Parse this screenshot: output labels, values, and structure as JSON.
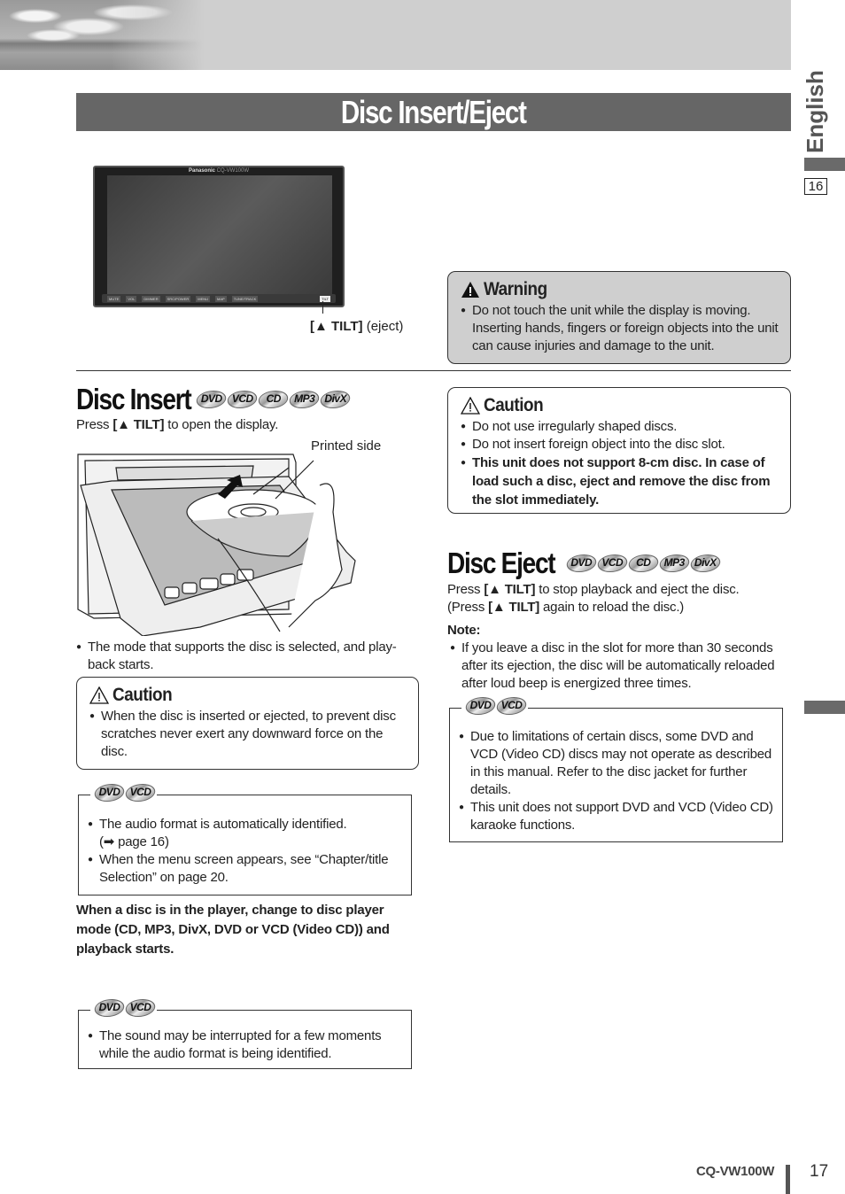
{
  "header": {
    "title": "Disc Insert/Eject"
  },
  "side_tab": {
    "language": "English",
    "page_ref": "16"
  },
  "device_photo": {
    "brand": "Panasonic",
    "model_small": "CQ-VW100W",
    "controls": [
      "MUTE",
      "–",
      "VOL",
      "+",
      "DIMMER",
      "SRC/POWER",
      "MENU",
      "MAP",
      "TUNE/TRACK",
      "TILT"
    ],
    "eject_label_key": "[▲ TILT]",
    "eject_label_desc": "(eject)"
  },
  "warning": {
    "title": "Warning",
    "icon": "warning-triangle-filled-icon",
    "items": [
      "Do not touch the unit while the display is moving. Inserting hands, fingers or foreign objects into the unit can cause injuries and damage to the unit."
    ]
  },
  "disc_insert": {
    "heading": "Disc Insert",
    "formats": [
      "DVD",
      "VCD",
      "CD",
      "MP3",
      "DivX"
    ],
    "instruction_pre": "Press ",
    "instruction_key": "[▲ TILT]",
    "instruction_post": " to open the display.",
    "printed_side_label": "Printed side",
    "after_note": "The mode that supports the disc is selected, and play-back starts.",
    "caution": {
      "title": "Caution",
      "items": [
        "When the disc is inserted or ejected, to prevent disc scratches never exert any downward force on the disc."
      ]
    },
    "dvd_vcd_box_1": {
      "formats": [
        "DVD",
        "VCD"
      ],
      "item1_text": "The audio format is automatically identified.",
      "item1_ref": "(➡ page 16)",
      "item2": "When the menu screen appears, see “Chapter/title Selection” on page 20."
    },
    "bold_paragraph": "When a disc is in the player, change to disc player mode (CD, MP3, DivX, DVD or VCD (Video CD)) and playback starts.",
    "dvd_vcd_box_2": {
      "formats": [
        "DVD",
        "VCD"
      ],
      "items": [
        "The sound may be interrupted for a few moments while the audio format is being identified."
      ]
    }
  },
  "caution_right": {
    "title": "Caution",
    "items": [
      {
        "text": "Do not use irregularly shaped discs.",
        "bold": false
      },
      {
        "text": "Do not insert foreign object into the disc slot.",
        "bold": false
      },
      {
        "text": "This unit does not support 8-cm disc. In case of load such a disc, eject and remove the disc from the slot immediately.",
        "bold": true
      }
    ]
  },
  "disc_eject": {
    "heading": "Disc Eject",
    "formats": [
      "DVD",
      "VCD",
      "CD",
      "MP3",
      "DivX"
    ],
    "line1_pre": "Press ",
    "line1_key": "[▲ TILT]",
    "line1_post": " to stop playback and eject the disc.",
    "line2_pre": "(Press ",
    "line2_key": "[▲ TILT]",
    "line2_post": " again to reload the disc.)",
    "note_label": "Note:",
    "note_items": [
      "If you leave a disc in the slot for more than 30 seconds after its ejection, the disc will be automatically reloaded after loud beep is energized three times."
    ],
    "dvd_vcd_box": {
      "formats": [
        "DVD",
        "VCD"
      ],
      "items": [
        "Due to limitations of certain discs, some DVD and VCD (Video CD) discs may not operate as described in this manual. Refer to the disc jacket for further details.",
        "This unit does not support DVD and VCD (Video CD) karaoke functions."
      ]
    }
  },
  "footer": {
    "model": "CQ-VW100W",
    "page_number": "17"
  }
}
